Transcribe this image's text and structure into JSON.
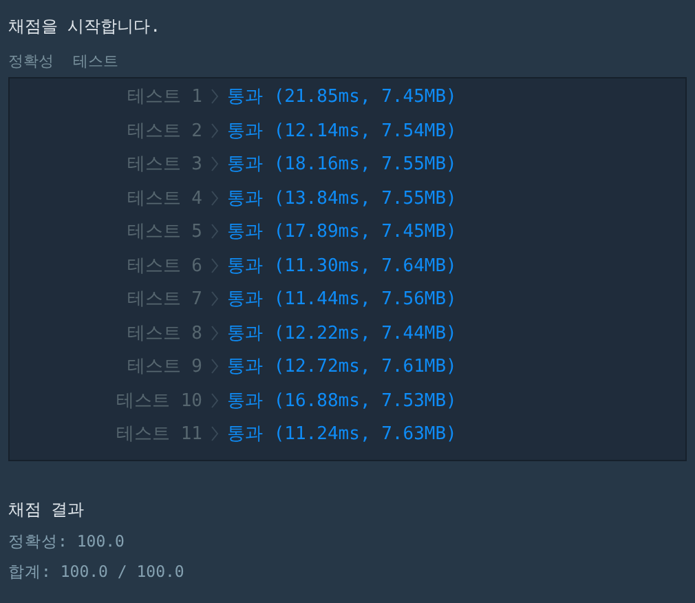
{
  "heading": "채점을 시작합니다.",
  "section_labels": [
    "정확성",
    "테스트"
  ],
  "tests": [
    {
      "label": "테스트 1",
      "result": "통과 (21.85ms, 7.45MB)"
    },
    {
      "label": "테스트 2",
      "result": "통과 (12.14ms, 7.54MB)"
    },
    {
      "label": "테스트 3",
      "result": "통과 (18.16ms, 7.55MB)"
    },
    {
      "label": "테스트 4",
      "result": "통과 (13.84ms, 7.55MB)"
    },
    {
      "label": "테스트 5",
      "result": "통과 (17.89ms, 7.45MB)"
    },
    {
      "label": "테스트 6",
      "result": "통과 (11.30ms, 7.64MB)"
    },
    {
      "label": "테스트 7",
      "result": "통과 (11.44ms, 7.56MB)"
    },
    {
      "label": "테스트 8",
      "result": "통과 (12.22ms, 7.44MB)"
    },
    {
      "label": "테스트 9",
      "result": "통과 (12.72ms, 7.61MB)"
    },
    {
      "label": "테스트 10",
      "result": "통과 (16.88ms, 7.53MB)"
    },
    {
      "label": "테스트 11",
      "result": "통과 (11.24ms, 7.63MB)"
    }
  ],
  "summary": {
    "title": "채점 결과",
    "lines": [
      "정확성: 100.0",
      "합계: 100.0 / 100.0"
    ]
  }
}
